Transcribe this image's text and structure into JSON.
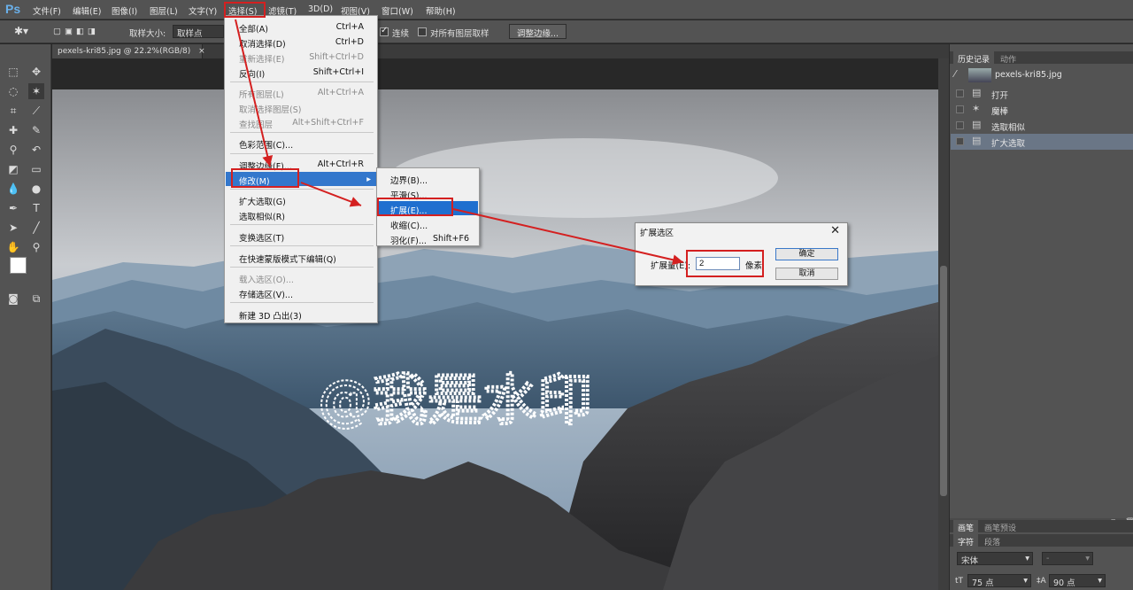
{
  "app": {
    "logo": "Ps"
  },
  "menubar": {
    "items": [
      "文件(F)",
      "编辑(E)",
      "图像(I)",
      "图层(L)",
      "文字(Y)",
      "选择(S)",
      "滤镜(T)",
      "3D(D)",
      "视图(V)",
      "窗口(W)",
      "帮助(H)"
    ]
  },
  "options": {
    "sample_size_label": "取样大小:",
    "sample_size_value": "取样点",
    "contiguous_label": "连续",
    "all_layers_label": "对所有图层取样",
    "refine_edge_label": "调整边缘..."
  },
  "document": {
    "tab_title": "pexels-kri85.jpg @ 22.2%(RGB/8)",
    "tab_close": "×"
  },
  "watermark": "@我是水印",
  "select_menu": {
    "items": [
      {
        "label": "全部(A)",
        "shortcut": "Ctrl+A",
        "disabled": false
      },
      {
        "label": "取消选择(D)",
        "shortcut": "Ctrl+D",
        "disabled": false
      },
      {
        "label": "重新选择(E)",
        "shortcut": "Shift+Ctrl+D",
        "disabled": true
      },
      {
        "label": "反向(I)",
        "shortcut": "Shift+Ctrl+I",
        "disabled": false
      },
      {
        "label": "所有图层(L)",
        "shortcut": "Alt+Ctrl+A",
        "disabled": true
      },
      {
        "label": "取消选择图层(S)",
        "shortcut": "",
        "disabled": true
      },
      {
        "label": "查找图层",
        "shortcut": "Alt+Shift+Ctrl+F",
        "disabled": true
      },
      {
        "label": "色彩范围(C)...",
        "shortcut": "",
        "disabled": false
      },
      {
        "label": "调整边缘(F)...",
        "shortcut": "Alt+Ctrl+R",
        "disabled": false
      },
      {
        "label": "修改(M)",
        "shortcut": "",
        "disabled": false
      },
      {
        "label": "扩大选取(G)",
        "shortcut": "",
        "disabled": false
      },
      {
        "label": "选取相似(R)",
        "shortcut": "",
        "disabled": false
      },
      {
        "label": "变换选区(T)",
        "shortcut": "",
        "disabled": false
      },
      {
        "label": "在快速蒙版模式下编辑(Q)",
        "shortcut": "",
        "disabled": false
      },
      {
        "label": "载入选区(O)...",
        "shortcut": "",
        "disabled": true
      },
      {
        "label": "存储选区(V)...",
        "shortcut": "",
        "disabled": false
      },
      {
        "label": "新建 3D 凸出(3)",
        "shortcut": "",
        "disabled": false
      }
    ]
  },
  "modify_submenu": {
    "items": [
      {
        "label": "边界(B)...",
        "shortcut": ""
      },
      {
        "label": "平滑(S)...",
        "shortcut": ""
      },
      {
        "label": "扩展(E)...",
        "shortcut": ""
      },
      {
        "label": "收缩(C)...",
        "shortcut": ""
      },
      {
        "label": "羽化(F)...",
        "shortcut": "Shift+F6"
      }
    ]
  },
  "expand_dialog": {
    "title": "扩展选区",
    "close": "✕",
    "label": "扩展量(E):",
    "value": "2",
    "unit": "像素",
    "ok": "确定",
    "cancel": "取消"
  },
  "history_panel": {
    "tabs": [
      "历史记录",
      "动作"
    ],
    "snapshot": "pexels-kri85.jpg",
    "steps": [
      "打开",
      "魔棒",
      "选取相似",
      "扩大选取"
    ]
  },
  "brush_panel": {
    "tabs": [
      "画笔",
      "画笔预设"
    ]
  },
  "character_panel": {
    "tabs": [
      "字符",
      "段落"
    ],
    "font_family": "宋体",
    "font_style": "-",
    "font_size": "75 点",
    "leading": "90 点"
  },
  "colors": {
    "highlight_red": "#d42020",
    "menu_highlight": "#3377cc"
  }
}
